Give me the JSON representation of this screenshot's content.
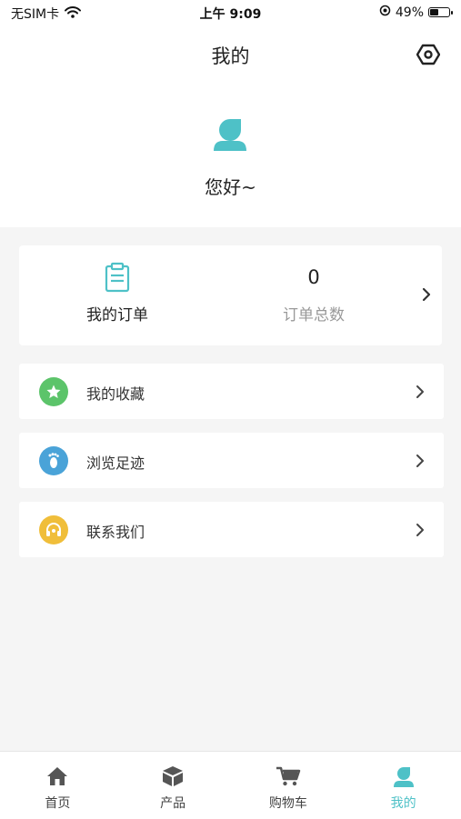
{
  "status_bar": {
    "carrier": "无SIM卡",
    "time": "上午 9:09",
    "battery_percent": "49%",
    "battery_level": 0.49
  },
  "nav": {
    "title": "我的"
  },
  "profile": {
    "greeting": "您好~"
  },
  "orders": {
    "my_orders_label": "我的订单",
    "total_count": "0",
    "total_label": "订单总数"
  },
  "menu": {
    "items": [
      {
        "label": "我的收藏",
        "icon": "star-icon",
        "color": "#5cc46a"
      },
      {
        "label": "浏览足迹",
        "icon": "footprint-icon",
        "color": "#4aa3d8"
      },
      {
        "label": "联系我们",
        "icon": "headset-icon",
        "color": "#f0be3a"
      }
    ]
  },
  "tabs": [
    {
      "label": "首页",
      "icon": "home-icon"
    },
    {
      "label": "产品",
      "icon": "box-icon"
    },
    {
      "label": "购物车",
      "icon": "cart-icon"
    },
    {
      "label": "我的",
      "icon": "user-icon",
      "active": true
    }
  ],
  "colors": {
    "accent": "#4ec1c7",
    "tab_icon_inactive": "#555555",
    "background": "#f5f5f5"
  }
}
